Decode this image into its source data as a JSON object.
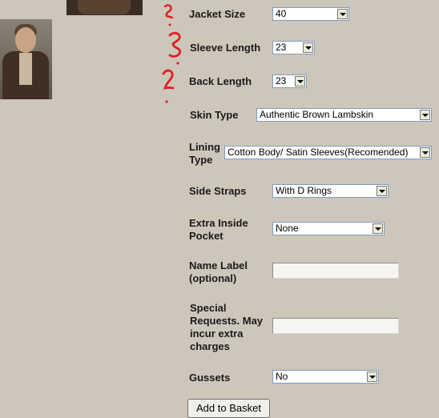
{
  "options": [
    {
      "label": "Jacket Size",
      "value": "40"
    },
    {
      "label": "Sleeve Length",
      "value": "23"
    },
    {
      "label": "Back Length",
      "value": "23"
    },
    {
      "label": "Skin Type",
      "value": "Authentic Brown Lambskin"
    },
    {
      "label_line1": "Lining",
      "label_line2": "Type",
      "value": "Cotton Body/ Satin Sleeves(Recomended)"
    },
    {
      "label": "Side Straps",
      "value": "With D Rings"
    },
    {
      "label_line1": "Extra Inside",
      "label_line2": "Pocket",
      "value": "None"
    },
    {
      "label_line1": "Name Label",
      "label_line2": "(optional)",
      "value": ""
    },
    {
      "label_line1": "Special",
      "label_line2": "Requests. May",
      "label_line3": "incur extra",
      "label_line4": "charges",
      "value": ""
    },
    {
      "label": "Gussets",
      "value": "No"
    }
  ],
  "add_to_basket_label": "Add to Basket",
  "annotation_color": "#e02020"
}
